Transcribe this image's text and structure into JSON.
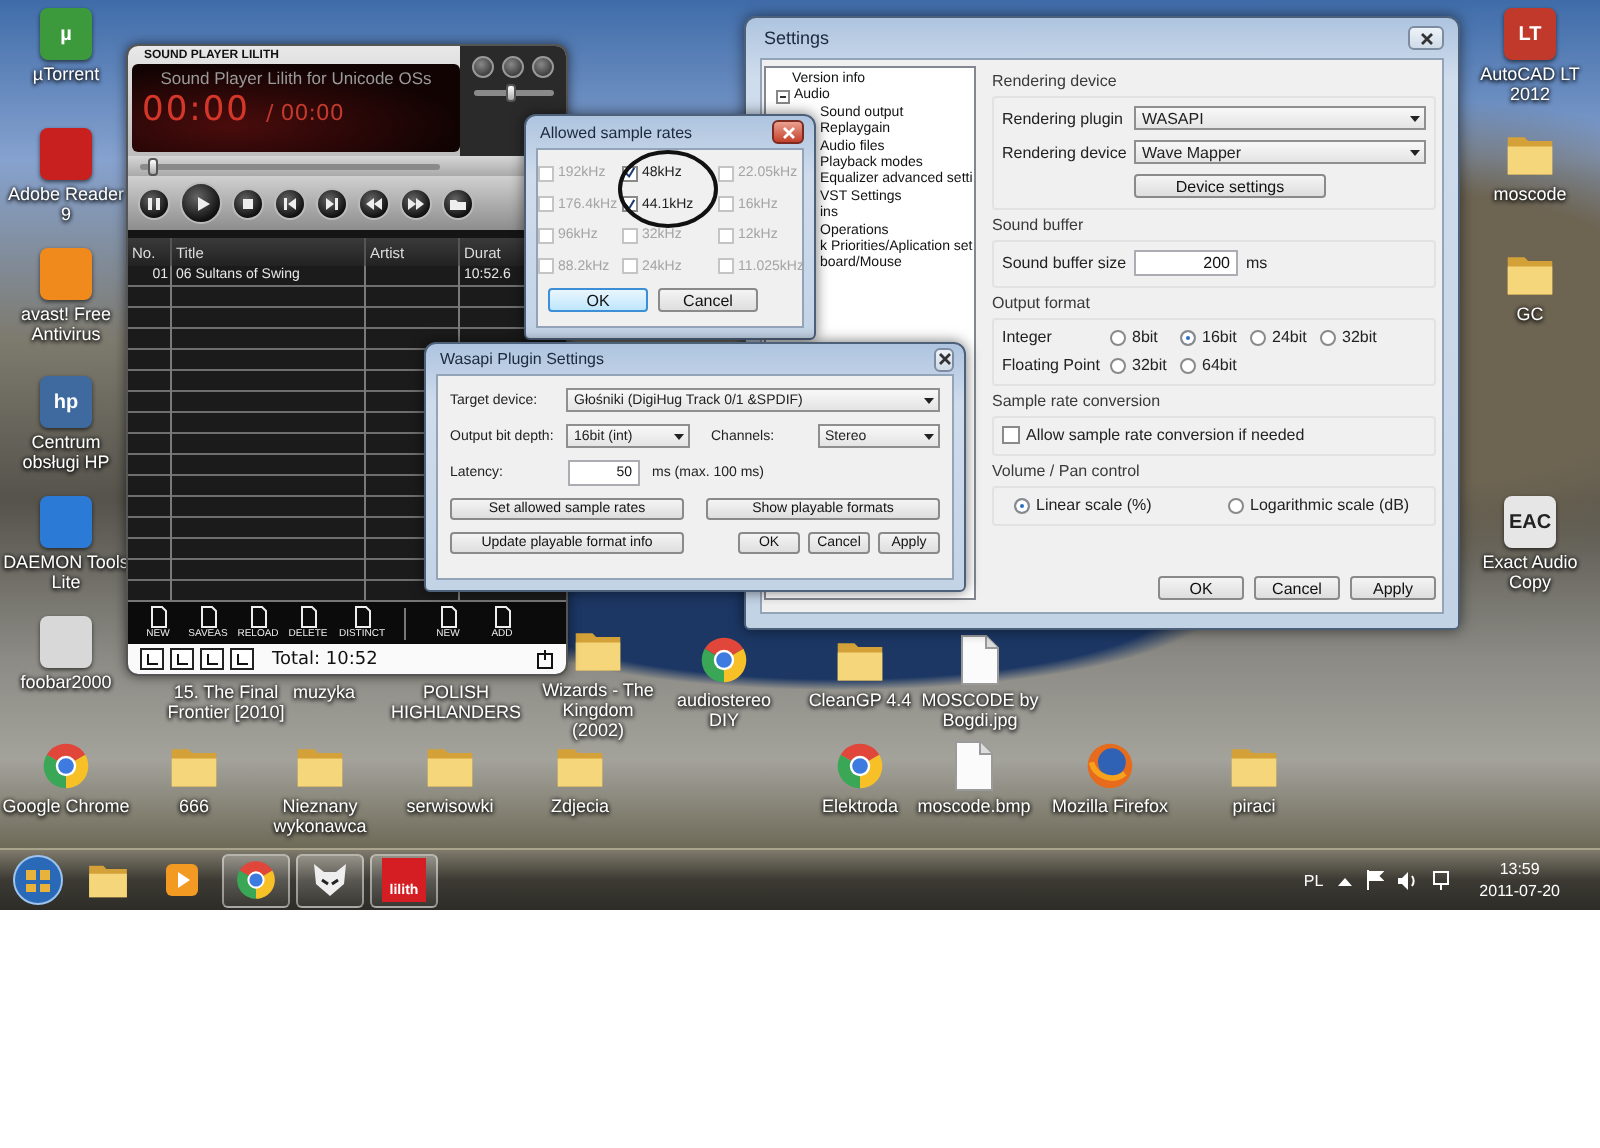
{
  "desktop_icons": [
    {
      "label": "µTorrent",
      "kind": "app",
      "logo_text": "µ"
    },
    {
      "label": "Adobe Reader 9",
      "kind": "app"
    },
    {
      "label": "avast! Free Antivirus",
      "kind": "app"
    },
    {
      "label": "Centrum obsługi HP",
      "kind": "app",
      "logo_text": "hp"
    },
    {
      "label": "DAEMON Tools Lite",
      "kind": "app"
    },
    {
      "label": "foobar2000",
      "kind": "app"
    },
    {
      "label": "Google Chrome",
      "kind": "chrome"
    },
    {
      "label": "15. The Final Frontier [2010]"
    },
    {
      "label": "muzyka"
    },
    {
      "label": "POLISH HIGHLANDERS"
    },
    {
      "label": "Wizards - The Kingdom (2002)",
      "kind": "folder"
    },
    {
      "label": "audiostereo DIY",
      "kind": "chrome"
    },
    {
      "label": "CleanGP 4.4",
      "kind": "folder"
    },
    {
      "label": "MOSCODE by Bogdi.jpg",
      "kind": "document"
    },
    {
      "label": "666",
      "kind": "folder"
    },
    {
      "label": "Nieznany wykonawca",
      "kind": "folder"
    },
    {
      "label": "serwisowki",
      "kind": "folder"
    },
    {
      "label": "Zdjecia",
      "kind": "folder"
    },
    {
      "label": "Elektroda",
      "kind": "chrome"
    },
    {
      "label": "moscode.bmp",
      "kind": "document"
    },
    {
      "label": "Mozilla Firefox",
      "kind": "firefox"
    },
    {
      "label": "piraci",
      "kind": "folder"
    },
    {
      "label": "AutoCAD LT 2012",
      "kind": "app",
      "logo_text": "LT"
    },
    {
      "label": "moscode",
      "kind": "folder"
    },
    {
      "label": "GC",
      "kind": "folder"
    },
    {
      "label": "Exact Audio Copy",
      "kind": "app",
      "logo_text": "EAC"
    }
  ],
  "player": {
    "title": "SOUND PLAYER LILITH",
    "marquee": "Sound Player Lilith for Unicode OSs",
    "time": "00:00",
    "duration": "/ 00:00",
    "volume": {
      "level": 0.45
    },
    "seek": {
      "level": 0.04
    },
    "columns": [
      "No.",
      "Title",
      "Artist",
      "Durat"
    ],
    "tracks": [
      {
        "number": "01",
        "title": "06 Sultans of Swing",
        "duration": "10:52.6"
      }
    ],
    "tools": [
      "NEW",
      "SAVEAS",
      "RELOAD",
      "DELETE",
      "DISTINCT"
    ],
    "list_tools": [
      "NEW",
      "ADD"
    ],
    "total": "Total: 10:52"
  },
  "settings": {
    "title": "Settings",
    "tree": [
      {
        "label": "Version info"
      },
      {
        "label": "Audio",
        "expanded": true,
        "children": [
          {
            "label": "Sound output"
          },
          {
            "label": "Replaygain"
          },
          {
            "label": "Audio files"
          },
          {
            "label": "Playback modes"
          },
          {
            "label": "Equalizer advanced setti"
          },
          {
            "label": "VST Settings"
          },
          {
            "label": "ins"
          },
          {
            "label": "Operations"
          },
          {
            "label": "k Priorities/Aplication set"
          },
          {
            "label": "board/Mouse"
          }
        ]
      }
    ],
    "rendering": {
      "heading": "Rendering device",
      "plugin_label": "Rendering plugin",
      "plugin": "WASAPI",
      "device_label": "Rendering device",
      "device": "Wave Mapper",
      "button": "Device settings"
    },
    "buffer": {
      "heading": "Sound buffer",
      "label": "Sound buffer size",
      "value": "200",
      "unit": "ms"
    },
    "output_format": {
      "heading": "Output format",
      "rows": [
        {
          "label": "Integer",
          "options": [
            {
              "label": "8bit",
              "selected": false
            },
            {
              "label": "16bit",
              "selected": true
            },
            {
              "label": "24bit",
              "selected": false
            },
            {
              "label": "32bit",
              "selected": false
            }
          ]
        },
        {
          "label": "Floating Point",
          "options": [
            {
              "label": "32bit",
              "selected": false
            },
            {
              "label": "64bit",
              "selected": false
            }
          ]
        }
      ]
    },
    "conversion": {
      "heading": "Sample rate conversion",
      "label": "Allow sample rate conversion if needed",
      "checked": false
    },
    "volume": {
      "heading": "Volume / Pan control",
      "options": [
        {
          "label": "Linear scale (%)",
          "selected": true
        },
        {
          "label": "Logarithmic scale (dB)",
          "selected": false
        }
      ]
    },
    "buttons": [
      "OK",
      "Cancel",
      "Apply"
    ]
  },
  "sample_rates_dialog": {
    "title": "Allowed sample rates",
    "rates": [
      {
        "label": "192kHz",
        "checked": false,
        "disabled": true
      },
      {
        "label": "48kHz",
        "checked": true,
        "disabled": false
      },
      {
        "label": "22.05kHz",
        "checked": false,
        "disabled": true
      },
      {
        "label": "176.4kHz",
        "checked": false,
        "disabled": true
      },
      {
        "label": "44.1kHz",
        "checked": true,
        "disabled": false
      },
      {
        "label": "16kHz",
        "checked": false,
        "disabled": true
      },
      {
        "label": "96kHz",
        "checked": false,
        "disabled": true
      },
      {
        "label": "32kHz",
        "checked": false,
        "disabled": true
      },
      {
        "label": "12kHz",
        "checked": false,
        "disabled": true
      },
      {
        "label": "88.2kHz",
        "checked": false,
        "disabled": true
      },
      {
        "label": "24kHz",
        "checked": false,
        "disabled": true
      },
      {
        "label": "11.025kHz",
        "checked": false,
        "disabled": true
      }
    ],
    "buttons": [
      "OK",
      "Cancel"
    ]
  },
  "wasapi_dialog": {
    "title": "Wasapi Plugin Settings",
    "target_label": "Target device:",
    "target": "Głośniki (DigiHug Track 0/1 &SPDIF)",
    "depth_label": "Output bit depth:",
    "depth": "16bit (int)",
    "channels_label": "Channels:",
    "channels": "Stereo",
    "latency_label": "Latency:",
    "latency": "50",
    "latency_note": "ms  (max. 100 ms)",
    "buttons": [
      "Set allowed sample rates",
      "Show playable formats",
      "Update playable format info",
      "OK",
      "Cancel",
      "Apply"
    ]
  },
  "taskbar": {
    "apps": [
      {
        "kind": "explorer",
        "running": false
      },
      {
        "kind": "media",
        "running": false
      },
      {
        "kind": "chrome",
        "running": true
      },
      {
        "kind": "foobar",
        "running": true
      },
      {
        "kind": "lilith",
        "running": true,
        "logo_text": "lilith"
      }
    ],
    "language": "PL",
    "time": "13:59",
    "date": "2011-07-20"
  }
}
